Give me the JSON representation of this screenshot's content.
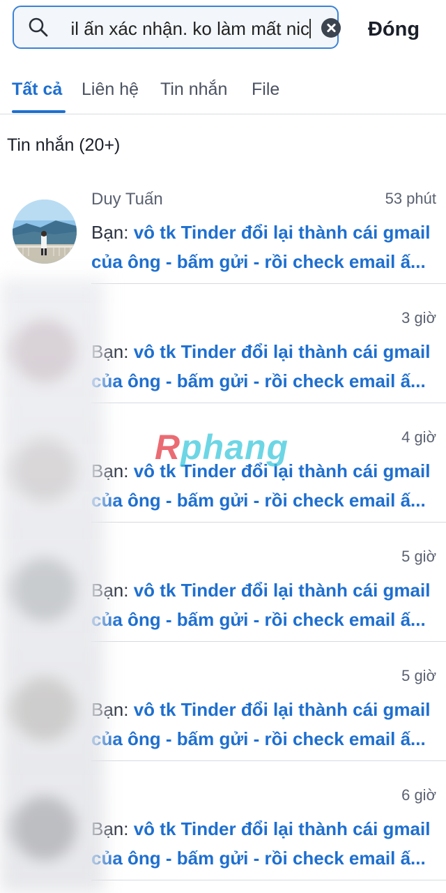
{
  "search": {
    "value": "il ấn xác nhận. ko làm mất nic",
    "close_label": "Đóng"
  },
  "tabs": [
    {
      "label": "Tất cả",
      "active": true
    },
    {
      "label": "Liên hệ",
      "active": false
    },
    {
      "label": "Tin nhắn",
      "active": false
    },
    {
      "label": "File",
      "active": false
    }
  ],
  "section": {
    "title": "Tin nhắn (20+)"
  },
  "messages": [
    {
      "name": "Duy Tuấn",
      "time": "53 phút",
      "prefix": "Bạn: ",
      "line1": "vô tk Tinder đổi lại thành cái gmail",
      "line2": "của ông - bấm gửi - rồi check email ấ..."
    },
    {
      "name": "",
      "time": "3 giờ",
      "prefix": "Bạn: ",
      "line1": "vô tk Tinder đổi lại thành cái gmail",
      "line2": "của ông - bấm gửi - rồi check email ấ..."
    },
    {
      "name": "",
      "time": "4 giờ",
      "prefix": "Bạn: ",
      "line1": "vô tk Tinder đổi lại thành cái gmail",
      "line2": "của ông - bấm gửi - rồi check email ấ..."
    },
    {
      "name": "",
      "time": "5 giờ",
      "prefix": "Bạn: ",
      "line1": "vô tk Tinder đổi lại thành cái gmail",
      "line2": "của ông - bấm gửi - rồi check email ấ..."
    },
    {
      "name": "",
      "time": "5 giờ",
      "prefix": "Bạn: ",
      "line1": "vô tk Tinder đổi lại thành cái gmail",
      "line2": "của ông - bấm gửi - rồi check email ấ..."
    },
    {
      "name": "",
      "time": "6 giờ",
      "prefix": "Bạn: ",
      "line1": "vô tk Tinder đổi lại thành cái gmail",
      "line2": "của ông - bấm gửi - rồi check email ấ..."
    }
  ],
  "watermark": {
    "text": "Rphang"
  },
  "colors": {
    "accent": "#1e6fd0",
    "search_border": "#3b82d6"
  }
}
